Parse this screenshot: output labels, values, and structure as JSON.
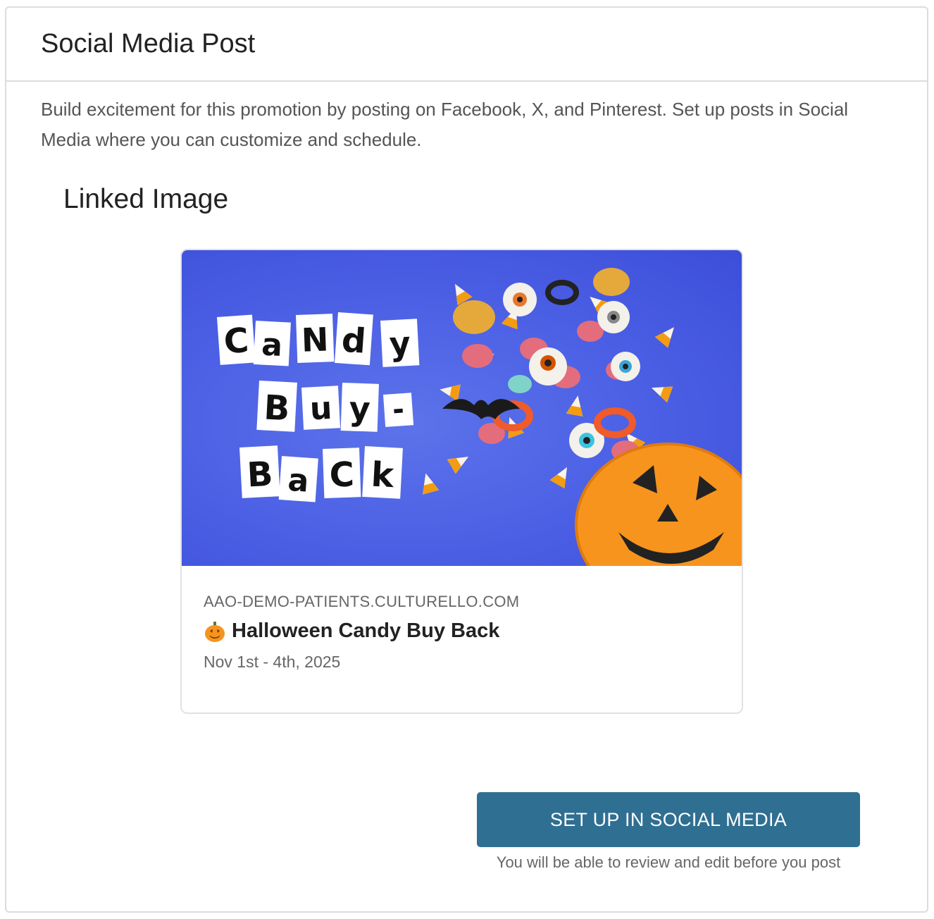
{
  "panel": {
    "title": "Social Media Post",
    "description": "Build excitement for this promotion by posting on Facebook, X, and Pinterest. Set up posts in Social Media where you can customize and schedule."
  },
  "linked_image": {
    "section_title": "Linked Image",
    "image_text_lines": [
      "Candy",
      "Buy-",
      "Back"
    ],
    "domain": "AAO-DEMO-PATIENTS.CULTURELLO.COM",
    "title_icon": "jack-o-lantern-icon",
    "title": "Halloween Candy Buy Back",
    "subtitle": "Nov 1st - 4th, 2025"
  },
  "actions": {
    "setup_button_label": "SET UP IN SOCIAL MEDIA",
    "setup_note": "You will be able to review and edit before you post"
  },
  "colors": {
    "button": "#2f6f92",
    "image_background": "#4a5ee4",
    "pumpkin": "#f7941d"
  }
}
